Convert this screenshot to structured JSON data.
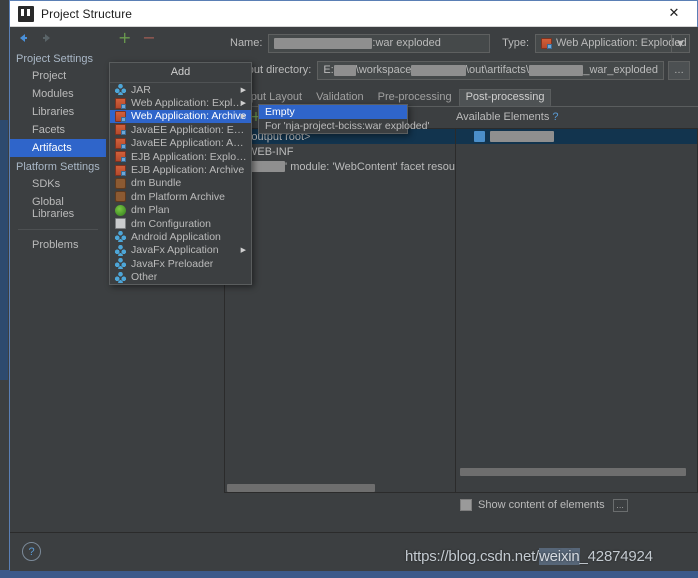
{
  "window": {
    "title": "Project Structure",
    "icon": "intellij-idea-icon",
    "close_label": "✕"
  },
  "sidebar": {
    "nav": {
      "back_icon": "back-arrow-icon",
      "forward_icon": "forward-arrow-icon"
    },
    "groups": [
      {
        "label": "Project Settings",
        "items": [
          {
            "label": "Project",
            "selected": false
          },
          {
            "label": "Modules",
            "selected": false
          },
          {
            "label": "Libraries",
            "selected": false
          },
          {
            "label": "Facets",
            "selected": false
          },
          {
            "label": "Artifacts",
            "selected": true
          }
        ]
      },
      {
        "label": "Platform Settings",
        "items": [
          {
            "label": "SDKs",
            "selected": false
          },
          {
            "label": "Global Libraries",
            "selected": false
          }
        ]
      }
    ],
    "problems": {
      "label": "Problems"
    }
  },
  "artifact_toolbar": {
    "add_label": "+",
    "remove_label": "−"
  },
  "details": {
    "name_label": "Name:",
    "name_value_suffix": ":war exploded",
    "name_redacted_width": 98,
    "type_label": "Type:",
    "type_value": "Web Application: Exploded",
    "type_icon": "web-application-exploded-icon",
    "type_arrow": "▼",
    "output_dir_label": "Output directory:",
    "output_dir_parts": [
      {
        "text": "E:"
      },
      {
        "redact": 34
      },
      {
        "text": "\\workspace"
      },
      {
        "redact": 84
      },
      {
        "text": "\\out\\artifacts\\"
      },
      {
        "redact": 84
      },
      {
        "text": "_war_exploded"
      }
    ],
    "browse_label": "…"
  },
  "tabs": [
    {
      "label": "Output Layout",
      "active": false
    },
    {
      "label": "Validation",
      "active": false
    },
    {
      "label": "Pre-processing",
      "active": false
    },
    {
      "label": "Post-processing",
      "active": true
    }
  ],
  "tree_toolbar": {
    "icons": [
      {
        "name": "show-included-only-icon",
        "glyph": "‖"
      },
      {
        "name": "add-copy-of-icon",
        "glyph": "+"
      },
      {
        "name": "remove-element-icon",
        "glyph": "−"
      },
      {
        "name": "sort-by-type-icon",
        "glyph": "⇅"
      },
      {
        "name": "move-up-icon",
        "glyph": "↑"
      },
      {
        "name": "move-down-icon",
        "glyph": "↓"
      }
    ],
    "available_elements_label": "Available Elements",
    "help_label": "?"
  },
  "output_tree": [
    {
      "label": "<output root>",
      "icon": "folder-icon",
      "indent": 0,
      "selected": true
    },
    {
      "label": "WEB-INF",
      "icon": "bar-icon",
      "indent": 1,
      "selected": false
    },
    {
      "label": "' module: 'WebContent' facet resou",
      "icon": "bar-icon",
      "indent": 1,
      "selected": false,
      "redact": 66
    }
  ],
  "available_tree": [
    {
      "label": "",
      "icon": "library-folder-icon",
      "indent": 0,
      "selected": true,
      "redact": 64
    }
  ],
  "bottom": {
    "show_content_label": "Show content of elements",
    "show_content_checked": false,
    "extra_button_label": "…"
  },
  "footer": {
    "help_label": "?"
  },
  "add_menu": {
    "title": "Add",
    "items": [
      {
        "label": "JAR",
        "icon": "jar-icon",
        "icon_type": "diamond",
        "submenu": true,
        "selected": false
      },
      {
        "label": "Web Application: Exploded",
        "icon": "web-application-exploded-icon",
        "icon_type": "webapp",
        "submenu": true,
        "selected": false
      },
      {
        "label": "Web Application: Archive",
        "icon": "web-application-archive-icon",
        "icon_type": "webapp",
        "submenu": true,
        "selected": true
      },
      {
        "label": "JavaEE Application: Exploded",
        "icon": "javaee-application-exploded-icon",
        "icon_type": "webapp",
        "submenu": false,
        "selected": false
      },
      {
        "label": "JavaEE Application: Archive",
        "icon": "javaee-application-archive-icon",
        "icon_type": "webapp",
        "submenu": false,
        "selected": false
      },
      {
        "label": "EJB Application: Exploded",
        "icon": "ejb-application-exploded-icon",
        "icon_type": "webapp",
        "submenu": false,
        "selected": false
      },
      {
        "label": "EJB Application: Archive",
        "icon": "ejb-application-archive-icon",
        "icon_type": "webapp",
        "submenu": false,
        "selected": false
      },
      {
        "label": "dm Bundle",
        "icon": "dm-bundle-icon",
        "icon_type": "bundle",
        "submenu": false,
        "selected": false
      },
      {
        "label": "dm Platform Archive",
        "icon": "dm-platform-archive-icon",
        "icon_type": "bundle",
        "submenu": false,
        "selected": false
      },
      {
        "label": "dm Plan",
        "icon": "dm-plan-icon",
        "icon_type": "plan",
        "submenu": false,
        "selected": false
      },
      {
        "label": "dm Configuration",
        "icon": "dm-configuration-icon",
        "icon_type": "config",
        "submenu": false,
        "selected": false
      },
      {
        "label": "Android Application",
        "icon": "android-application-icon",
        "icon_type": "diamond",
        "submenu": false,
        "selected": false
      },
      {
        "label": "JavaFx Application",
        "icon": "javafx-application-icon",
        "icon_type": "diamond",
        "submenu": true,
        "selected": false
      },
      {
        "label": "JavaFx Preloader",
        "icon": "javafx-preloader-icon",
        "icon_type": "diamond",
        "submenu": false,
        "selected": false
      },
      {
        "label": "Other",
        "icon": "other-icon",
        "icon_type": "diamond",
        "submenu": false,
        "selected": false
      }
    ],
    "submenu": {
      "items": [
        {
          "label": "Empty",
          "selected": true
        },
        {
          "label": "For 'nja-project-bciss:war exploded'",
          "selected": false
        }
      ]
    }
  },
  "watermark": {
    "prefix": "https://blog.csdn.net/",
    "highlight": "weixin",
    "suffix": "_42874924"
  },
  "colors": {
    "accent_blue": "#2f65ca",
    "panel_bg": "#3c3f41",
    "text": "#bbbbbb",
    "selection_tree": "#12344e",
    "green_add": "#6a9a4e",
    "red_remove": "#9c5c54"
  }
}
